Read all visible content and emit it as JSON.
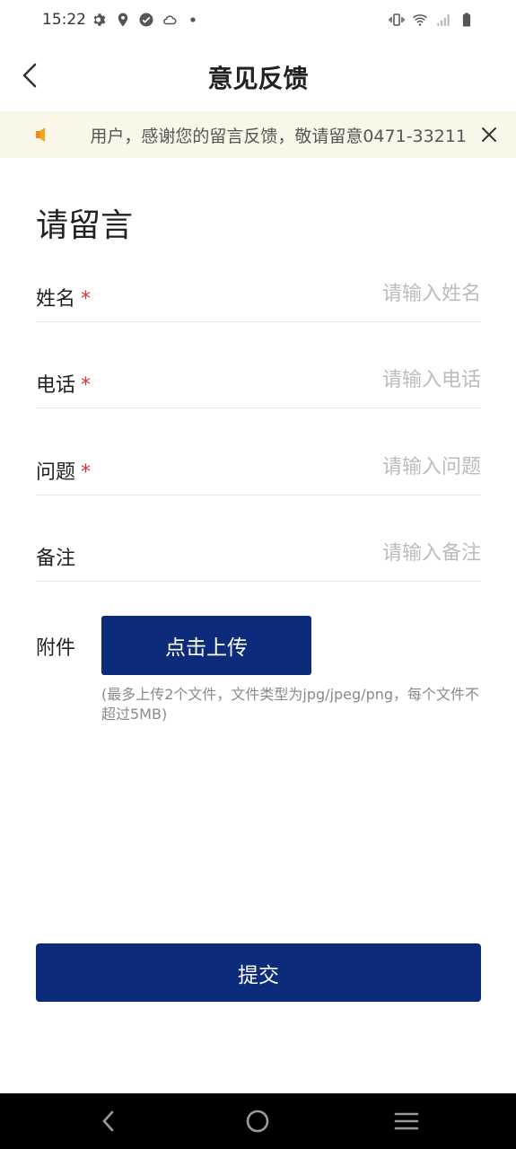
{
  "status_bar": {
    "time": "15:22",
    "left_icons": [
      "gear-icon",
      "location-pin-icon",
      "check-circle-icon",
      "cloud-icon",
      "dot-icon"
    ],
    "right_icons": [
      "vibrate-icon",
      "wifi-icon",
      "signal-icon",
      "battery-icon"
    ]
  },
  "app_bar": {
    "title": "意见反馈",
    "back_icon": "chevron-left-icon"
  },
  "notice": {
    "icon": "speaker-icon",
    "text": "用户，感谢您的留言反馈，敬请留意0471-33211",
    "close_icon": "close-icon",
    "accent_color": "#f5a623",
    "background": "#fbf7e8"
  },
  "form": {
    "heading": "请留言",
    "required_mark": "*",
    "fields": [
      {
        "label": "姓名",
        "required": true,
        "placeholder": "请输入姓名",
        "value": ""
      },
      {
        "label": "电话",
        "required": true,
        "placeholder": "请输入电话",
        "value": ""
      },
      {
        "label": "问题",
        "required": true,
        "placeholder": "请输入问题",
        "value": ""
      },
      {
        "label": "备注",
        "required": false,
        "placeholder": "请输入备注",
        "value": ""
      }
    ],
    "attachment": {
      "label": "附件",
      "button_label": "点击上传",
      "hint": "(最多上传2个文件，文件类型为jpg/jpeg/png，每个文件不超过5MB)"
    },
    "submit_label": "提交"
  },
  "colors": {
    "primary": "#0c2b7a",
    "required": "#d9303a"
  },
  "nav_bar": {
    "icons": [
      "nav-back-icon",
      "nav-home-icon",
      "nav-menu-icon"
    ]
  }
}
